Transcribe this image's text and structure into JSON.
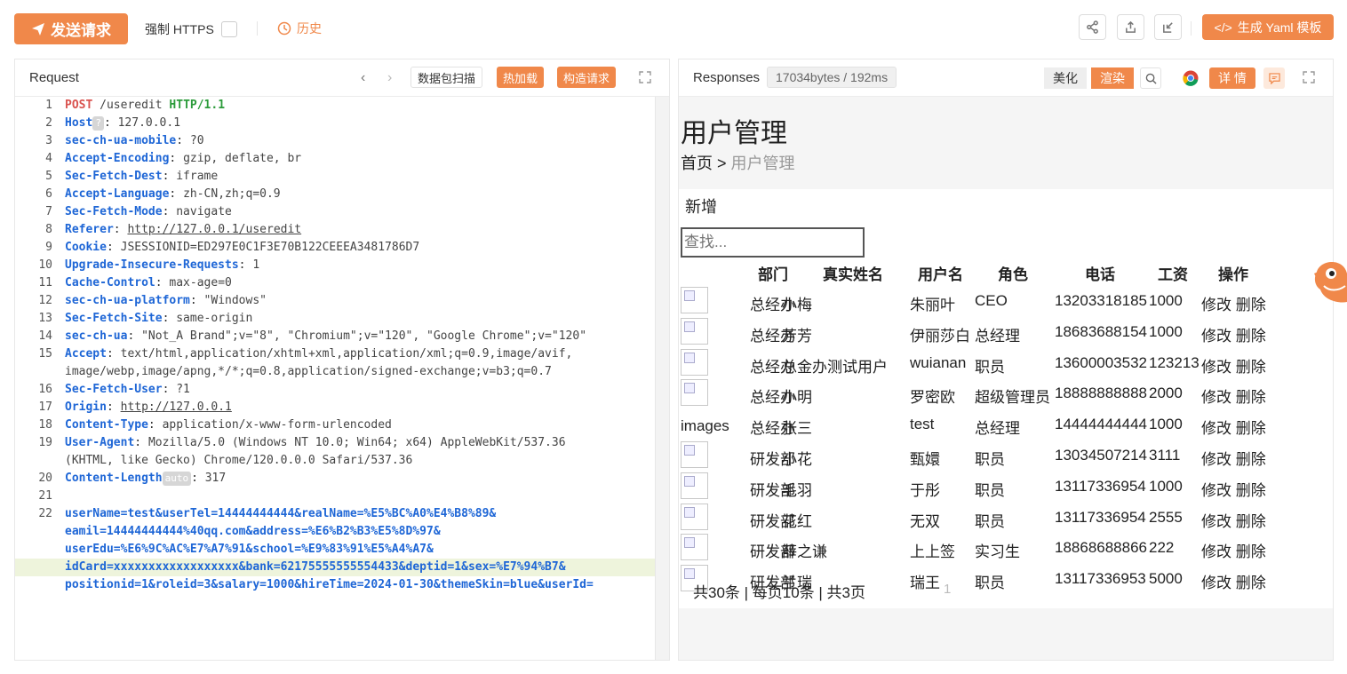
{
  "toolbar": {
    "send_label": "发送请求",
    "force_https_label": "强制 HTTPS",
    "history_label": "历史",
    "yaml_label": "生成 Yaml 模板"
  },
  "request": {
    "title": "Request",
    "scan_label": "数据包扫描",
    "hot_load_label": "热加载",
    "build_label": "构造请求",
    "lines": [
      {
        "n": "1"
      },
      {
        "n": "2"
      },
      {
        "n": "3"
      },
      {
        "n": "4"
      },
      {
        "n": "5"
      },
      {
        "n": "6"
      },
      {
        "n": "7"
      },
      {
        "n": "8"
      },
      {
        "n": "9"
      },
      {
        "n": "10"
      },
      {
        "n": "11"
      },
      {
        "n": "12"
      },
      {
        "n": "13"
      },
      {
        "n": "14"
      },
      {
        "n": "15"
      },
      {
        "n": "16"
      },
      {
        "n": "17"
      },
      {
        "n": "18"
      },
      {
        "n": "19"
      },
      {
        "n": "20"
      },
      {
        "n": "21"
      },
      {
        "n": "22"
      }
    ],
    "method": "POST",
    "path": "/useredit",
    "protocol": "HTTP/1.1",
    "headers": {
      "host_k": "Host",
      "host_tag": "?",
      "host_v": "127.0.0.1",
      "mobile_k": "sec-ch-ua-mobile",
      "mobile_v": "?0",
      "enc_k": "Accept-Encoding",
      "enc_v": "gzip, deflate, br",
      "dest_k": "Sec-Fetch-Dest",
      "dest_v": "iframe",
      "lang_k": "Accept-Language",
      "lang_v": "zh-CN,zh;q=0.9",
      "mode_k": "Sec-Fetch-Mode",
      "mode_v": "navigate",
      "ref_k": "Referer",
      "ref_v": "http://127.0.0.1/useredit",
      "cookie_k": "Cookie",
      "cookie_v": "JSESSIONID=ED297E0C1F3E70B122CEEEA3481786D7",
      "uir_k": "Upgrade-Insecure-Requests",
      "uir_v": "1",
      "cc_k": "Cache-Control",
      "cc_v": "max-age=0",
      "plat_k": "sec-ch-ua-platform",
      "plat_v": "\"Windows\"",
      "site_k": "Sec-Fetch-Site",
      "site_v": "same-origin",
      "ua_k": "sec-ch-ua",
      "ua_v": "\"Not_A Brand\";v=\"8\", \"Chromium\";v=\"120\", \"Google Chrome\";v=\"120\"",
      "acc_k": "Accept",
      "acc_v1": "text/html,application/xhtml+xml,application/xml;q=0.9,image/avif,",
      "acc_v2": "image/webp,image/apng,*/*;q=0.8,application/signed-exchange;v=b3;q=0.7",
      "user_k": "Sec-Fetch-User",
      "user_v": "?1",
      "origin_k": "Origin",
      "origin_v": "http://127.0.0.1",
      "ct_k": "Content-Type",
      "ct_v": "application/x-www-form-urlencoded",
      "agent_k": "User-Agent",
      "agent_v1": "Mozilla/5.0 (Windows NT 10.0; Win64; x64) AppleWebKit/537.36",
      "agent_v2": "(KHTML, like Gecko) Chrome/120.0.0.0 Safari/537.36",
      "cl_k": "Content-Length",
      "cl_tag": "auto",
      "cl_v": "317"
    },
    "body": [
      "userName=test&userTel=14444444444&realName=%E5%BC%A0%E4%B8%89&",
      "eamil=14444444444%40qq.com&address=%E6%B2%B3%E5%8D%97&",
      "userEdu=%E6%9C%AC%E7%A7%91&school=%E9%83%91%E5%A4%A7&",
      "idCard=xxxxxxxxxxxxxxxxxx&bank=62175555555554433&deptid=1&sex=%E7%94%B7&",
      "positionid=1&roleid=3&salary=1000&hireTime=2024-01-30&themeSkin=blue&userId="
    ]
  },
  "response": {
    "title": "Responses",
    "size_info": "17034bytes / 192ms",
    "beautify_label": "美化",
    "render_label": "渲染",
    "detail_label": "详 情",
    "page_title": "用户管理",
    "crumb_home": "首页",
    "crumb_sep": ">",
    "crumb_current": "用户管理",
    "add_label": "新增",
    "search_placeholder": "查找...",
    "headers": [
      "部门",
      "真实姓名",
      "用户名",
      "角色",
      "电话",
      "工资",
      "操作"
    ],
    "rows": [
      {
        "img": "",
        "dept": "总经办",
        "name": "小梅",
        "user": "朱丽叶",
        "role": "CEO",
        "phone": "13203318185",
        "salary": "1000",
        "ops": "修改 删除"
      },
      {
        "img": "",
        "dept": "总经办",
        "name": "芳芳",
        "user": "伊丽莎白",
        "role": "总经理",
        "phone": "18683688154",
        "salary": "1000",
        "ops": "修改 删除"
      },
      {
        "img": "",
        "dept": "总经办",
        "name": "总金办测试用户",
        "user": "wuianan",
        "role": "职员",
        "phone": "13600003532",
        "salary": "123213",
        "ops": "修改 删除"
      },
      {
        "img": "",
        "dept": "总经办",
        "name": "小明",
        "user": "罗密欧",
        "role": "超级管理员",
        "phone": "18888888888",
        "salary": "2000",
        "ops": "修改 删除"
      },
      {
        "img": "images",
        "dept": "总经办",
        "name": "张三",
        "user": "test",
        "role": "总经理",
        "phone": "14444444444",
        "salary": "1000",
        "ops": "修改 删除"
      },
      {
        "img": "",
        "dept": "研发部",
        "name": "小花",
        "user": "甄嬛",
        "role": "职员",
        "phone": "13034507214",
        "salary": "3111",
        "ops": "修改 删除"
      },
      {
        "img": "",
        "dept": "研发部",
        "name": "毛羽",
        "user": "于彤",
        "role": "职员",
        "phone": "13117336954",
        "salary": "1000",
        "ops": "修改 删除"
      },
      {
        "img": "",
        "dept": "研发部",
        "name": "花红",
        "user": "无双",
        "role": "职员",
        "phone": "13117336954",
        "salary": "2555",
        "ops": "修改 删除"
      },
      {
        "img": "",
        "dept": "研发部",
        "name": "薛之谦",
        "user": "上上签",
        "role": "实习生",
        "phone": "18868688866",
        "salary": "222",
        "ops": "修改 删除"
      },
      {
        "img": "",
        "dept": "研发部",
        "name": "兰瑞",
        "user": "瑞王",
        "role": "职员",
        "phone": "13117336953",
        "salary": "5000",
        "ops": "修改 删除"
      }
    ],
    "pager_text": "共30条 | 每页10条 | 共3页",
    "pager_num": "1"
  },
  "colors": {
    "accent": "#f0884a",
    "key": "#1e66d6",
    "method": "#d9534f",
    "protocol": "#2b9b3a"
  }
}
